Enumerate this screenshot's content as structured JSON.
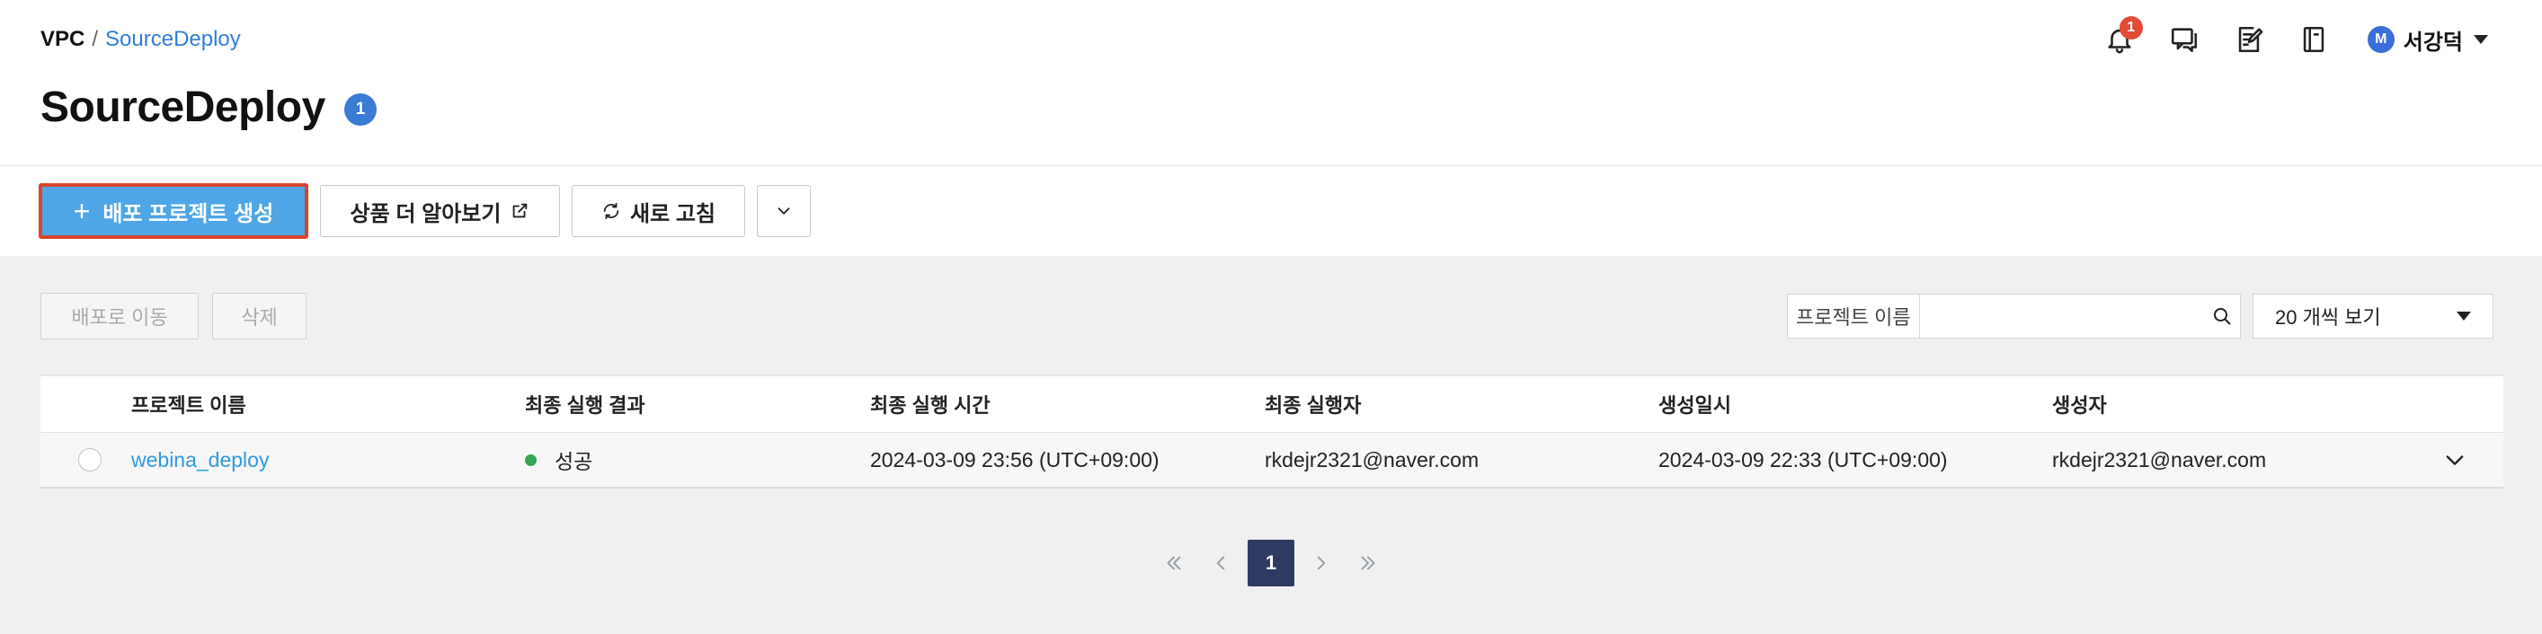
{
  "breadcrumb": {
    "root": "VPC",
    "separator": "/",
    "current": "SourceDeploy"
  },
  "page": {
    "title": "SourceDeploy",
    "count_badge": "1"
  },
  "header": {
    "notification_count": "1",
    "icons": [
      "bell-icon",
      "chat-icon",
      "memo-icon",
      "book-icon"
    ],
    "user": {
      "avatar_letter": "M",
      "name": "서강덕"
    }
  },
  "toolbar": {
    "create_label": "배포 프로젝트 생성",
    "learn_label": "상품 더 알아보기",
    "refresh_label": "새로 고침"
  },
  "actions": {
    "move_label": "배포로 이동",
    "delete_label": "삭제"
  },
  "search": {
    "label": "프로젝트 이름",
    "value": ""
  },
  "page_size": {
    "selected": "20 개씩 보기"
  },
  "table": {
    "columns": [
      "프로젝트 이름",
      "최종 실행 결과",
      "최종 실행 시간",
      "최종 실행자",
      "생성일시",
      "생성자"
    ],
    "rows": [
      {
        "name": "webina_deploy",
        "result": "성공",
        "last_run": "2024-03-09 23:56 (UTC+09:00)",
        "runner": "rkdejr2321@naver.com",
        "created_at": "2024-03-09 22:33 (UTC+09:00)",
        "creator": "rkdejr2321@naver.com"
      }
    ]
  },
  "pagination": {
    "current": "1"
  },
  "colors": {
    "accent": "#4ea6e6",
    "highlight_border": "#d9452f",
    "success": "#33a853",
    "badge": "#3a7bd5",
    "pagination_active": "#2e3a61"
  }
}
